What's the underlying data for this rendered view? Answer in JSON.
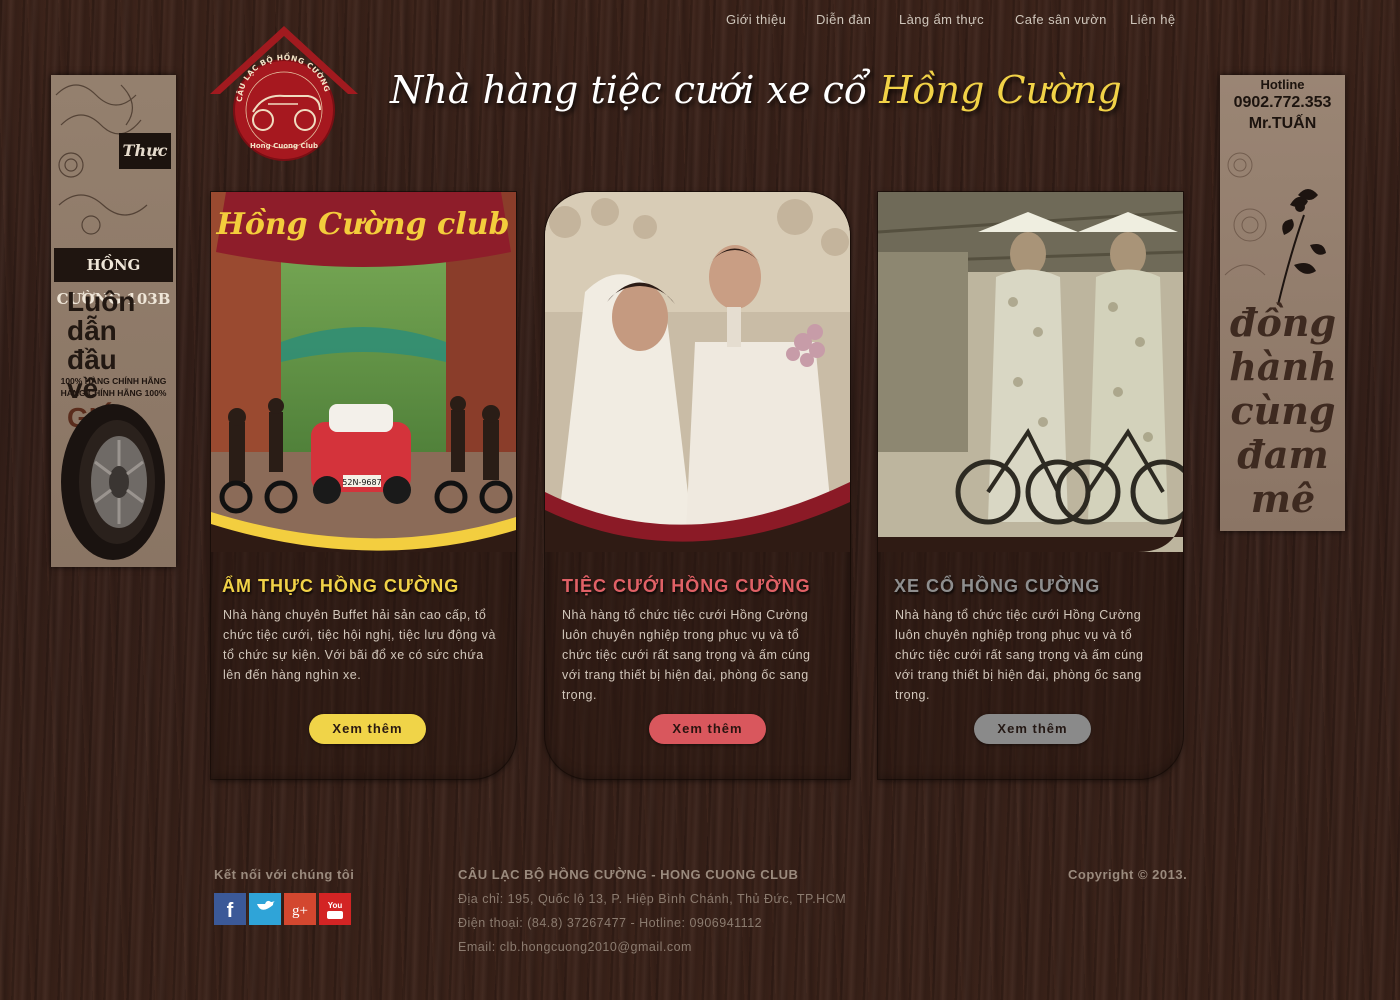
{
  "nav": {
    "items": [
      {
        "label": "Giới thiệu"
      },
      {
        "label": "Diễn đàn"
      },
      {
        "label": "Làng ẩm thực"
      },
      {
        "label": "Cafe sân vườn"
      },
      {
        "label": "Liên hệ"
      }
    ]
  },
  "header": {
    "title_main": "Nhà hàng tiệc cưới xe cổ",
    "title_accent": "Hồng Cường",
    "logo_arc_text": "CÂU LẠC BỘ HỒNG CƯỜNG",
    "logo_bottom_text": "Hong Cuong Club"
  },
  "left_banner": {
    "brand": "HỒNG CƯỜNG 103B",
    "logo_text": "Thực",
    "slogan": [
      "Luôn",
      "dẫn",
      "đầu",
      "về"
    ],
    "slogan_highlight": "GIÁ",
    "note_line1": "100% HÀNG CHÍNH HÃNG",
    "note_line2": "HÀNG CHÍNH HÃNG 100%"
  },
  "right_banner": {
    "hotline_label": "Hotline",
    "phone": "0902.772.353",
    "name": "Mr.TUẤN",
    "slogan": "đồng hành cùng đam mê"
  },
  "cards": [
    {
      "title": "ẨM THỰC HỒNG CƯỜNG",
      "description": "Nhà hàng chuyên Buffet hải sản cao cấp, tổ chức tiệc cưới, tiệc hội nghị, tiệc lưu động và tổ chức sự kiện. Với bãi đổ xe có sức chứa lên đến hàng nghìn xe.",
      "button_label": "Xem thêm",
      "photo_sign": "Hồng Cường club",
      "plate": "52N-9687",
      "color": "#f1d247"
    },
    {
      "title": "TIỆC CƯỚI HỒNG CƯỜNG",
      "description": "Nhà hàng tổ chức tiệc cưới Hồng Cường luôn chuyên nghiệp trong phục vụ và tổ chức tiệc cưới rất sang trọng và ấm cúng với trang thiết bị hiện đại, phòng ốc sang trọng.",
      "button_label": "Xem thêm",
      "color": "#e06166"
    },
    {
      "title": "XE CỔ HỒNG CƯỜNG",
      "description": "Nhà hàng tổ chức tiệc cưới Hồng Cường luôn chuyên nghiệp trong phục vụ và tổ chức tiệc cưới rất sang trọng và ấm cúng với trang thiết bị hiện đại, phòng ốc sang trọng.",
      "button_label": "Xem thêm",
      "color": "#8e8e8e"
    }
  ],
  "footer": {
    "connect_label": "Kết nối với chúng tôi",
    "socials": [
      {
        "name": "facebook",
        "glyph": "f",
        "color": "#3b5998"
      },
      {
        "name": "twitter",
        "glyph": "t",
        "color": "#2fa4d8"
      },
      {
        "name": "google-plus",
        "glyph": "g+",
        "color": "#d3472f"
      },
      {
        "name": "youtube",
        "glyph": "You",
        "color": "#d32424"
      }
    ],
    "club_name": "CÂU LẠC BỘ HỒNG CƯỜNG - HONG CUONG CLUB",
    "address": "Địa chỉ: 195, Quốc lộ 13, P. Hiệp Bình Chánh, Thủ Đức, TP.HCM",
    "phone": "Điện thoại: (84.8) 37267477 - Hotline: 0906941112",
    "email": "Email: clb.hongcuong2010@gmail.com",
    "copyright": "Copyright © 2013."
  }
}
